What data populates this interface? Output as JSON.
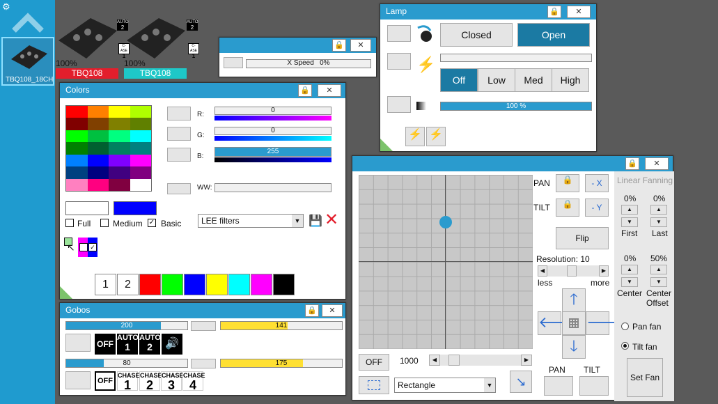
{
  "sidebar": {
    "fixture_label": "TBQ108_18CH",
    "gear_icon": "gear-icon",
    "up_icon": "chevron-up-icon"
  },
  "fixtures": [
    {
      "intensity": "100%",
      "name": "TBQ108",
      "color": "#e31e2c",
      "auto": "AUTO",
      "auto_num": "2",
      "chase": "C-ASE",
      "chase_num": "1"
    },
    {
      "intensity": "100%",
      "name": "TBQ108",
      "color": "#1ec8c8",
      "auto": "AUTO",
      "auto_num": "2",
      "chase": "C-ASE",
      "chase_num": "1"
    }
  ],
  "speed": {
    "label": "X Speed",
    "value": "0%"
  },
  "lamp": {
    "title": "Lamp",
    "closed": "Closed",
    "open": "Open",
    "off": "Off",
    "low": "Low",
    "med": "Med",
    "high": "High",
    "dimmer": "100 %"
  },
  "colors": {
    "title": "Colors",
    "r_label": "R:",
    "g_label": "G:",
    "b_label": "B:",
    "ww_label": "WW:",
    "r": "0",
    "g": "0",
    "b": "255",
    "r_pct": 0,
    "g_pct": 0,
    "b_pct": 100,
    "full": "Full",
    "medium": "Medium",
    "basic": "Basic",
    "filter": "LEE filters",
    "preset1": "1",
    "preset2": "2",
    "palette": [
      "#ff0000",
      "#ff8000",
      "#ffff00",
      "#b0ff00",
      "#800000",
      "#804000",
      "#808000",
      "#608000",
      "#00ff00",
      "#00c040",
      "#00ff80",
      "#00ffff",
      "#008000",
      "#006030",
      "#008060",
      "#008080",
      "#0080ff",
      "#0000ff",
      "#8000ff",
      "#ff00ff",
      "#004080",
      "#000080",
      "#400080",
      "#800080",
      "#ff80c0",
      "#ff0080",
      "#800040",
      "#ffffff"
    ],
    "swatches": [
      "#ff0000",
      "#00ff00",
      "#0000ff",
      "#ffff00",
      "#00ffff",
      "#ff00ff",
      "#000000"
    ],
    "current": "#0000ff"
  },
  "gobos": {
    "title": "Gobos",
    "bar1": "200",
    "bar1_pct": 0.78,
    "bar2": "141",
    "bar2_pct": 0.55,
    "bar3": "80",
    "bar3_pct": 0.31,
    "bar4": "175",
    "bar4_pct": 0.68,
    "off": "OFF",
    "auto": "AUTO",
    "auto1": "1",
    "auto2": "2",
    "off2": "OFF",
    "chase": "CHASE",
    "c1": "1",
    "c2": "2",
    "c3": "3",
    "c4": "4"
  },
  "position": {
    "pan": "PAN",
    "tilt": "TILT",
    "neg_x": "- X",
    "neg_y": "- Y",
    "flip": "Flip",
    "resolution": "Resolution: 10",
    "less": "less",
    "more": "more",
    "off": "OFF",
    "speed_val": "1000",
    "shape": "Rectangle",
    "pan_btn": "PAN",
    "tilt_btn": "TILT",
    "fan_title": "Linear Fanning",
    "first_val": "0%",
    "last_val": "0%",
    "first": "First",
    "last": "Last",
    "center_val": "0%",
    "offset_val": "50%",
    "center": "Center",
    "offset": "Center Offset",
    "pan_fan": "Pan fan",
    "tilt_fan": "Tilt fan",
    "set_fan": "Set Fan",
    "dot_x": 0.5,
    "dot_y": 0.27
  }
}
